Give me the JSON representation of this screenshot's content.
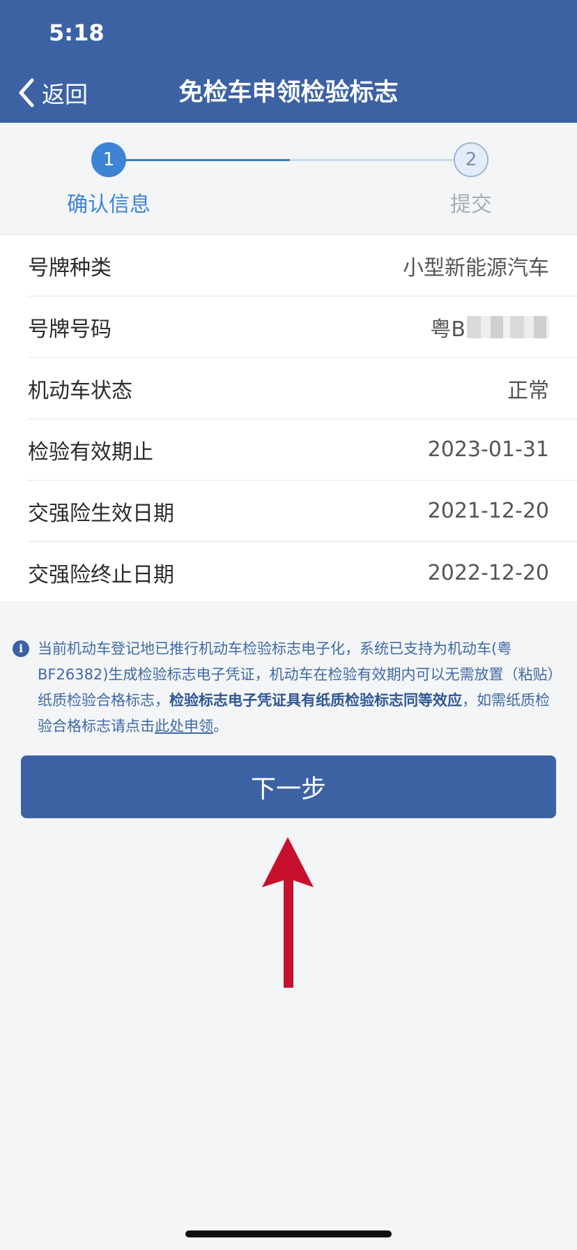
{
  "status_bar": {
    "time": "5:18"
  },
  "header": {
    "back_label": "返回",
    "title": "免检车申领检验标志"
  },
  "steps": [
    {
      "number": "1",
      "label": "确认信息",
      "active": true
    },
    {
      "number": "2",
      "label": "提交",
      "active": false
    }
  ],
  "info_rows": [
    {
      "label": "号牌种类",
      "value": "小型新能源汽车"
    },
    {
      "label": "号牌号码",
      "value": "粤B"
    },
    {
      "label": "机动车状态",
      "value": "正常"
    },
    {
      "label": "检验有效期止",
      "value": "2023-01-31"
    },
    {
      "label": "交强险生效日期",
      "value": "2021-12-20"
    },
    {
      "label": "交强险终止日期",
      "value": "2022-12-20"
    }
  ],
  "notice": {
    "icon": "info-icon",
    "text_part1": "当前机动车登记地已推行机动车检验标志电子化，系统已支持为机动车(粤BF26382)生成检验标志电子凭证，机动车在检验有效期内可以无需放置（粘贴）纸质检验合格标志，",
    "text_bold": "检验标志电子凭证具有纸质检验标志同等效应",
    "text_part2": "，如需纸质检验合格标志请点击",
    "link_text": "此处申领",
    "text_end": "。"
  },
  "next_button": {
    "label": "下一步"
  },
  "colors": {
    "header": "#3c62a4",
    "accent": "#3d84d6",
    "arrow": "#c8102e"
  }
}
